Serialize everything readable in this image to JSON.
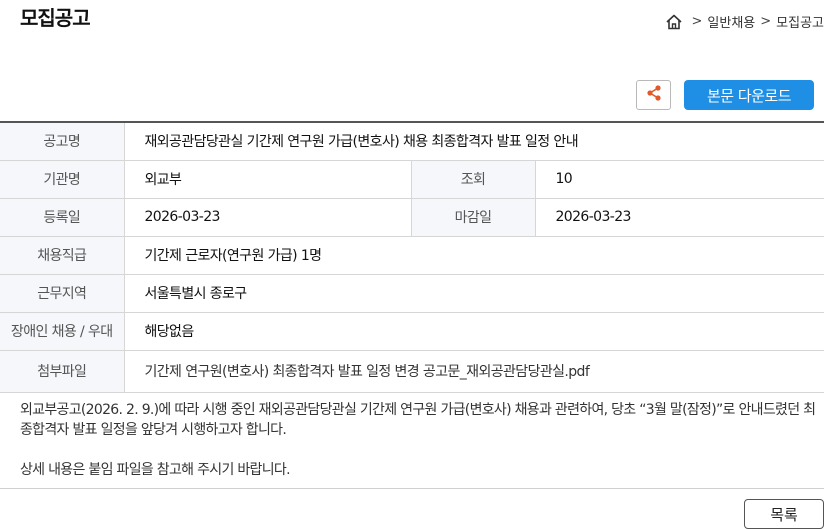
{
  "page": {
    "title": "모집공고"
  },
  "breadcrumb": {
    "items": [
      "일반채용",
      "모집공고"
    ]
  },
  "toolbar": {
    "download_label": "본문 다운로드"
  },
  "info": {
    "title_label": "공고명",
    "title_value": "재외공관담당관실 기간제 연구원 가급(변호사) 채용 최종합격자 발표 일정 안내",
    "agency_label": "기관명",
    "agency_value": "외교부",
    "views_label": "조회",
    "views_value": "10",
    "reg_label": "등록일",
    "reg_value": "2026-03-23",
    "deadline_label": "마감일",
    "deadline_value": "2026-03-23",
    "rank_label": "채용직급",
    "rank_value": "기간제 근로자(연구원 가급) 1명",
    "region_label": "근무지역",
    "region_value": "서울특별시 종로구",
    "disability_label": "장애인 채용 / 우대",
    "disability_value": "해당없음",
    "file_label": "첨부파일",
    "file_value": "기간제 연구원(변호사) 최종합격자 발표 일정 변경 공고문_재외공관담당관실.pdf"
  },
  "content": {
    "paragraph1": "외교부공고(2026. 2. 9.)에 따라 시행 중인 재외공관담당관실 기간제 연구원 가급(변호사) 채용과 관련하여, 당초 “3월 말(잠정)”로 안내드렸던 최종합격자 발표 일정을 앞당겨 시행하고자 합니다.",
    "paragraph2": "상세 내용은 붙임 파일을 참고해 주시기 바랍니다."
  },
  "footer": {
    "list_label": "목록"
  },
  "colors": {
    "accent": "#1f8fe5",
    "label_bg": "#f5f7fa"
  },
  "icons": {
    "home": "home-icon",
    "share": "share-icon"
  }
}
